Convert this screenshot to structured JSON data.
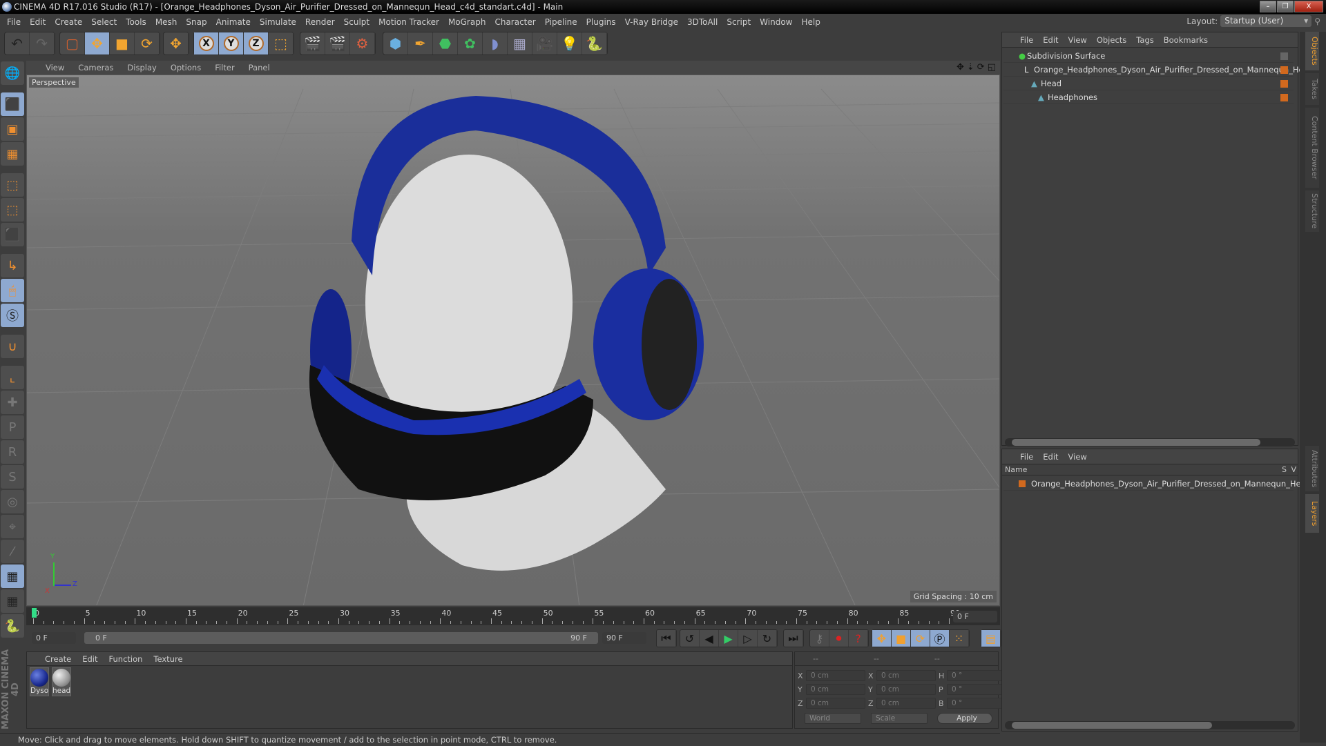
{
  "window": {
    "title": "CINEMA 4D R17.016 Studio (R17) - [Orange_Headphones_Dyson_Air_Purifier_Dressed_on_Mannequn_Head_c4d_standart.c4d] - Main",
    "minimize": "–",
    "restore": "❐",
    "close": "X"
  },
  "menubar": [
    "File",
    "Edit",
    "Create",
    "Select",
    "Tools",
    "Mesh",
    "Snap",
    "Animate",
    "Simulate",
    "Render",
    "Sculpt",
    "Motion Tracker",
    "MoGraph",
    "Character",
    "Pipeline",
    "Plugins",
    "V-Ray Bridge",
    "3DToAll",
    "Script",
    "Window",
    "Help"
  ],
  "layout": {
    "label": "Layout:",
    "value": "Startup (User)"
  },
  "viewport": {
    "menu": [
      "View",
      "Cameras",
      "Display",
      "Options",
      "Filter",
      "Panel"
    ],
    "camera": "Perspective",
    "grid_spacing": "Grid Spacing : 10 cm",
    "axis": {
      "x": "X",
      "y": "Y",
      "z": "Z"
    }
  },
  "timeline": {
    "ticks": [
      "0",
      "5",
      "10",
      "15",
      "20",
      "25",
      "30",
      "35",
      "40",
      "45",
      "50",
      "55",
      "60",
      "65",
      "70",
      "75",
      "80",
      "85",
      "90"
    ],
    "current_frame": "0 F",
    "start_field": "0 F",
    "range_start": "0 F",
    "range_end": "90 F",
    "end_field": "90 F"
  },
  "materials": {
    "menu": [
      "Create",
      "Edit",
      "Function",
      "Texture"
    ],
    "items": [
      {
        "label": "Dyso"
      },
      {
        "label": "head"
      }
    ]
  },
  "coords": {
    "headers": [
      "--",
      "--",
      "--"
    ],
    "rows": [
      {
        "a": "X",
        "av": "0 cm",
        "b": "X",
        "bv": "0 cm",
        "c": "H",
        "cv": "0 °"
      },
      {
        "a": "Y",
        "av": "0 cm",
        "b": "Y",
        "bv": "0 cm",
        "c": "P",
        "cv": "0 °"
      },
      {
        "a": "Z",
        "av": "0 cm",
        "b": "Z",
        "bv": "0 cm",
        "c": "B",
        "cv": "0 °"
      }
    ],
    "mode": "World",
    "type": "Scale",
    "apply": "Apply"
  },
  "status": "Move: Click and drag to move elements. Hold down SHIFT to quantize movement / add to the selection in point mode, CTRL to remove.",
  "objects": {
    "menu": [
      "File",
      "Edit",
      "View",
      "Objects",
      "Tags",
      "Bookmarks"
    ],
    "tree": [
      {
        "name": "Subdivision Surface"
      },
      {
        "name": "Orange_Headphones_Dyson_Air_Purifier_Dressed_on_Mannequn_Head"
      },
      {
        "name": "Head"
      },
      {
        "name": "Headphones"
      }
    ]
  },
  "layers": {
    "menu": [
      "File",
      "Edit",
      "View"
    ],
    "col_name": "Name",
    "col_s": "S",
    "col_v": "V",
    "items": [
      {
        "name": "Orange_Headphones_Dyson_Air_Purifier_Dressed_on_Mannequn_Head"
      }
    ]
  },
  "sidetabs": [
    "Objects",
    "Takes",
    "Content Browser",
    "Structure",
    "Attributes",
    "Layers"
  ],
  "brand": "MAXON CINEMA 4D",
  "colors": {
    "accent": "#f0a030",
    "layer": "#d2691e",
    "active": "#8ea9d0"
  }
}
